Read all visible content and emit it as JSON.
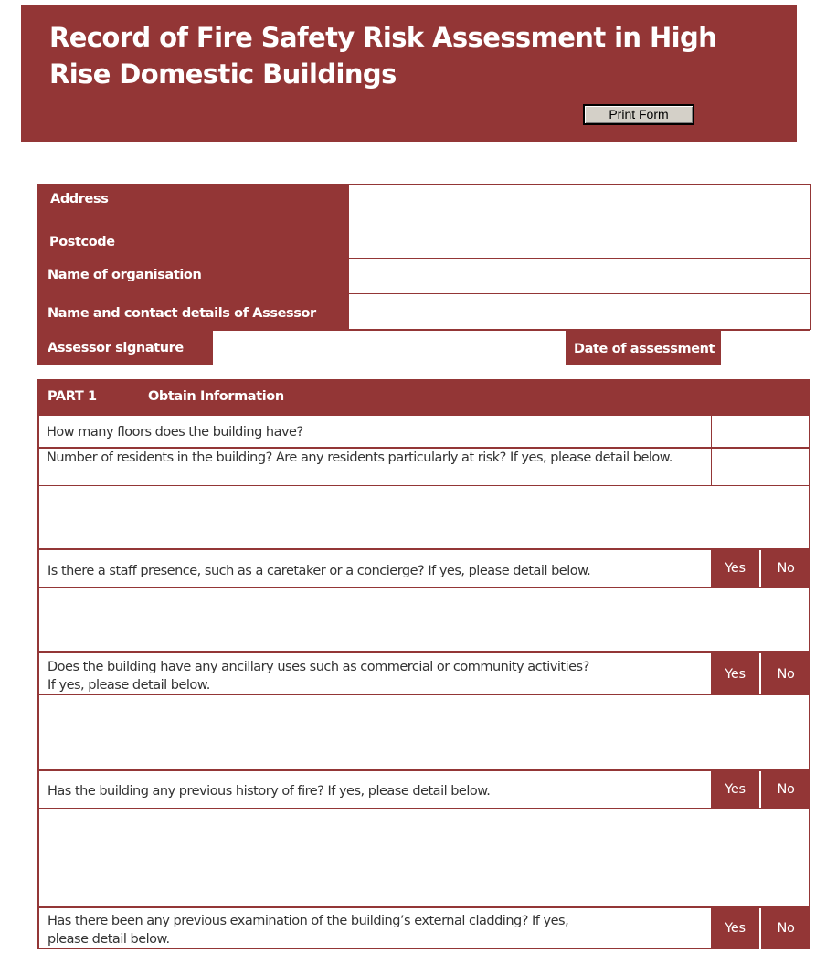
{
  "header": {
    "title": "Record of Fire Safety Risk Assessment in High Rise Domestic Buildings",
    "print_button_label": "Print Form"
  },
  "colors": {
    "brand": "#933636",
    "button_face": "#d4d0c8"
  },
  "details": {
    "address_label": "Address",
    "postcode_label": "Postcode",
    "organisation_label": "Name of organisation",
    "assessor_label": "Name and contact details of Assessor",
    "signature_label": "Assessor signature",
    "date_label": "Date of assessment",
    "address_value": "",
    "organisation_value": "",
    "assessor_value": "",
    "signature_value": "",
    "date_value": ""
  },
  "part1": {
    "part_label": "PART 1",
    "section_title": "Obtain Information",
    "questions": [
      {
        "text": "How many floors does the building have?",
        "answer": ""
      },
      {
        "text": "Number of residents in the building? Are any residents particularly at risk? If yes, please detail below.",
        "answer": "",
        "detail": ""
      },
      {
        "text": "Is there a staff presence, such as a caretaker or a concierge? If yes, please detail below.",
        "yes": "Yes",
        "no": "No",
        "detail": ""
      },
      {
        "text": "Does the building have any ancillary uses such as commercial or community activities?",
        "text2": "If yes, please detail below.",
        "yes": "Yes",
        "no": "No",
        "detail": ""
      },
      {
        "text": "Has the building any previous history of fire? If yes, please detail below.",
        "yes": "Yes",
        "no": "No",
        "detail": ""
      },
      {
        "text": "Has there been any previous examination of the building’s external cladding? If yes,",
        "text2": "please detail below.",
        "yes": "Yes",
        "no": "No"
      }
    ]
  }
}
